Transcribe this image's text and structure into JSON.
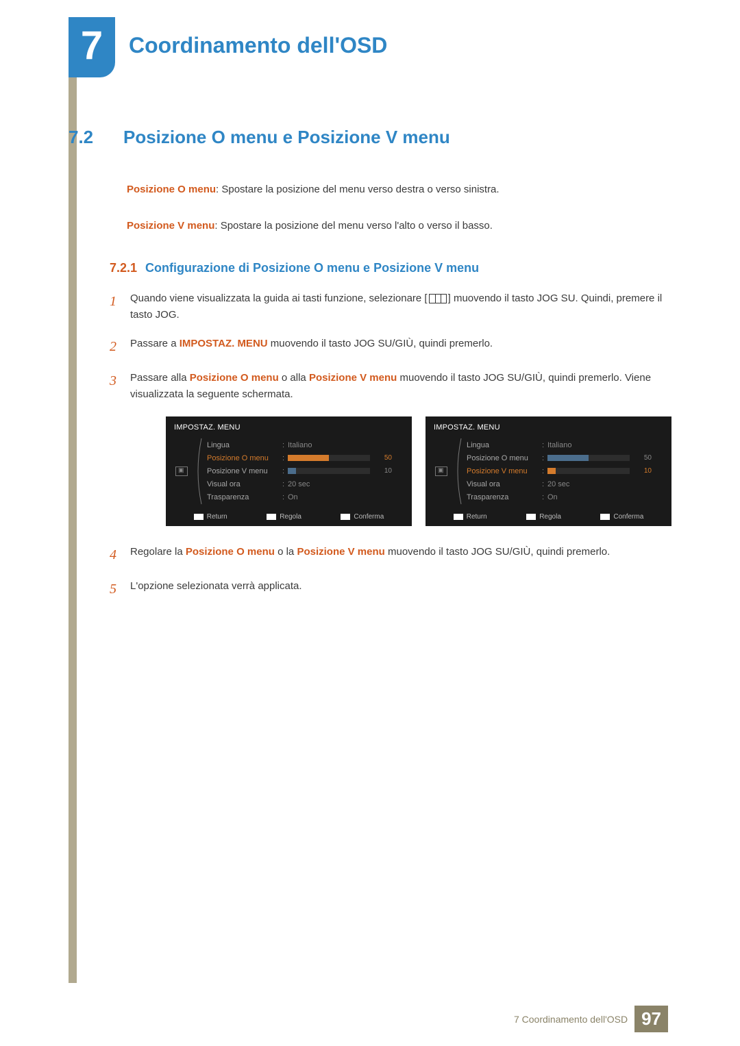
{
  "chapter": {
    "number": "7",
    "title": "Coordinamento dell'OSD"
  },
  "section": {
    "number": "7.2",
    "title": "Posizione O menu e Posizione V menu",
    "intro_o_term": "Posizione O menu",
    "intro_o_rest": ": Spostare la posizione del menu verso destra o verso sinistra.",
    "intro_v_term": "Posizione V menu",
    "intro_v_rest": ": Spostare la posizione del menu verso l'alto o verso il basso."
  },
  "subsection": {
    "number": "7.2.1",
    "title": "Configurazione di Posizione O menu e Posizione V menu"
  },
  "steps": {
    "s1a": "Quando viene visualizzata la guida ai tasti funzione, selezionare [",
    "s1b": "] muovendo il tasto JOG SU. Quindi, premere il tasto JOG.",
    "s2a": "Passare a ",
    "s2_term": "IMPOSTAZ. MENU",
    "s2b": " muovendo il tasto JOG SU/GIÙ, quindi premerlo.",
    "s3a": "Passare alla ",
    "s3_term1": "Posizione O menu",
    "s3b": " o alla ",
    "s3_term2": "Posizione V menu",
    "s3c": " muovendo il tasto JOG SU/GIÙ, quindi premerlo. Viene visualizzata la seguente schermata.",
    "s4a": "Regolare la ",
    "s4_term1": "Posizione O menu",
    "s4b": " o la ",
    "s4_term2": "Posizione V menu",
    "s4c": " muovendo il tasto JOG SU/GIÙ, quindi premerlo.",
    "s5": "L'opzione selezionata verrà applicata."
  },
  "osd": {
    "title": "IMPOSTAZ. MENU",
    "rows": {
      "lingua_label": "Lingua",
      "lingua_val": "Italiano",
      "poso_label": "Posizione O menu",
      "poso_val": "50",
      "posv_label": "Posizione V menu",
      "posv_val": "10",
      "visual_label": "Visual ora",
      "visual_val": "20 sec",
      "trasp_label": "Trasparenza",
      "trasp_val": "On"
    },
    "foot": {
      "return": "Return",
      "regola": "Regola",
      "conferma": "Conferma"
    }
  },
  "footer": {
    "text": "7 Coordinamento dell'OSD",
    "page": "97"
  }
}
